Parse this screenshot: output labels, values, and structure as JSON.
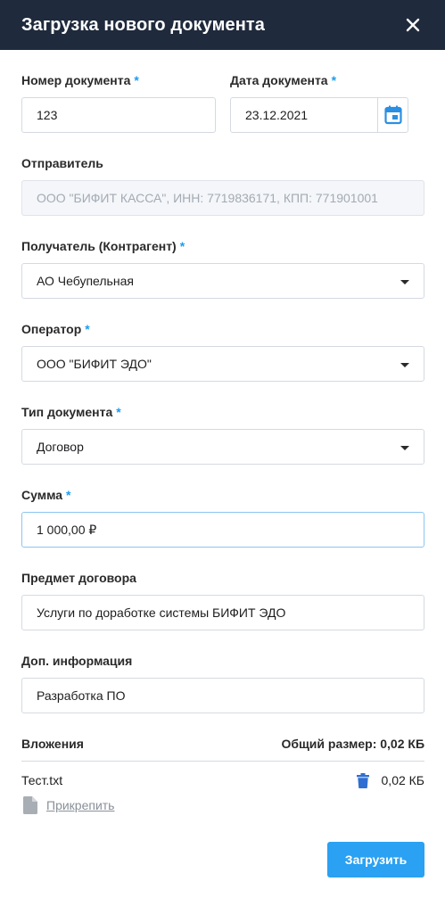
{
  "dialog": {
    "title": "Загрузка нового документа"
  },
  "fields": {
    "doc_number": {
      "label": "Номер документа",
      "required_mark": "*",
      "value": "123"
    },
    "doc_date": {
      "label": "Дата документа",
      "required_mark": "*",
      "value": "23.12.2021"
    },
    "sender": {
      "label": "Отправитель",
      "placeholder": "ООО \"БИФИТ КАССА\", ИНН: 7719836171, КПП: 771901001"
    },
    "recipient": {
      "label": "Получатель (Контрагент)",
      "required_mark": "*",
      "value": "АО Чебупельная"
    },
    "operator": {
      "label": "Оператор",
      "required_mark": "*",
      "value": "ООО \"БИФИТ ЭДО\""
    },
    "doc_type": {
      "label": "Тип документа",
      "required_mark": "*",
      "value": "Договор"
    },
    "amount": {
      "label": "Сумма",
      "required_mark": "*",
      "value": "1 000,00 ₽"
    },
    "subject": {
      "label": "Предмет договора",
      "value": "Услуги по доработке системы БИФИТ ЭДО"
    },
    "extra_info": {
      "label": "Доп. информация",
      "value": "Разработка ПО"
    }
  },
  "attachments": {
    "label": "Вложения",
    "total_size": "Общий размер: 0,02 КБ",
    "files": [
      {
        "name": "Тест.txt",
        "size": "0,02 КБ"
      }
    ],
    "attach_label": "Прикрепить"
  },
  "actions": {
    "submit_label": "Загрузить"
  },
  "colors": {
    "header_bg": "#1f2a3c",
    "accent": "#2aa1f2",
    "required_mark": "#1e9bf0",
    "trash_icon": "#2f6fd1"
  }
}
